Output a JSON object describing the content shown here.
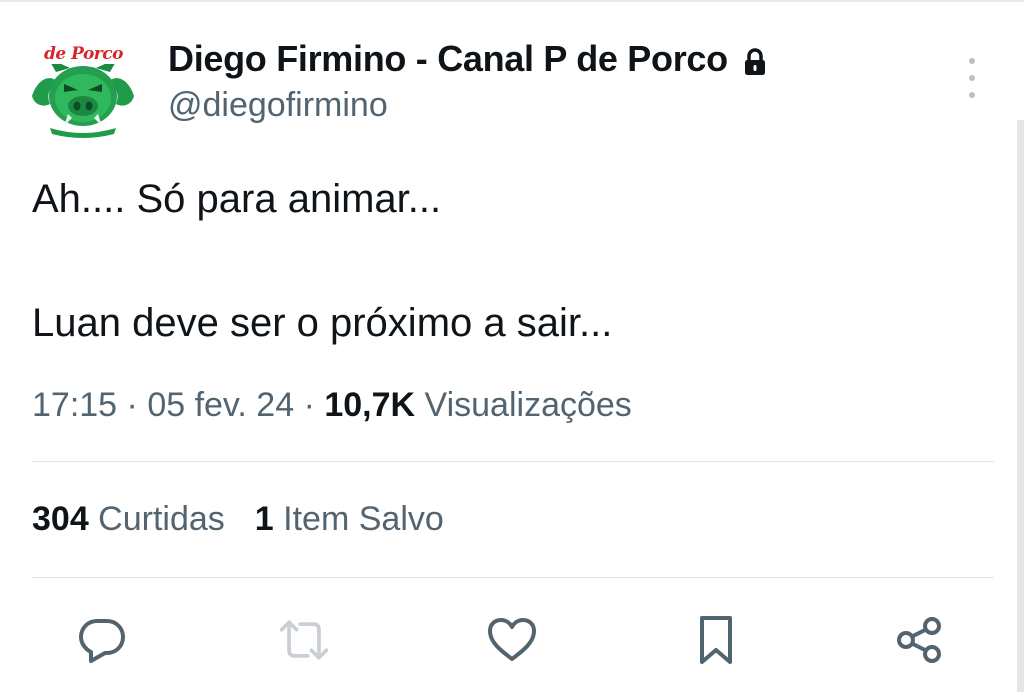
{
  "author": {
    "name": "Diego Firmino - Canal P de Porco",
    "handle": "@diegofirmino",
    "avatar_text": "de Porco",
    "protected_icon": "lock-icon"
  },
  "tweet": {
    "line1": "Ah.... Só para animar...",
    "line2": "Luan deve ser o próximo a sair..."
  },
  "meta": {
    "time": "17:15",
    "sep1": " · ",
    "date": "05 fev. 24",
    "sep2": " · ",
    "views_count": "10,7K",
    "views_label": " Visualizações"
  },
  "stats": {
    "likes_count": "304",
    "likes_label": " Curtidas",
    "saves_count": "1",
    "saves_label": " Item Salvo"
  },
  "actions": {
    "reply": "reply-icon",
    "retweet": "retweet-icon",
    "like": "heart-icon",
    "bookmark": "bookmark-icon",
    "share": "share-icon"
  },
  "colors": {
    "text_primary": "#0f1419",
    "text_secondary": "#536471",
    "avatar_green": "#1f9b4a",
    "avatar_red": "#d6262b"
  }
}
